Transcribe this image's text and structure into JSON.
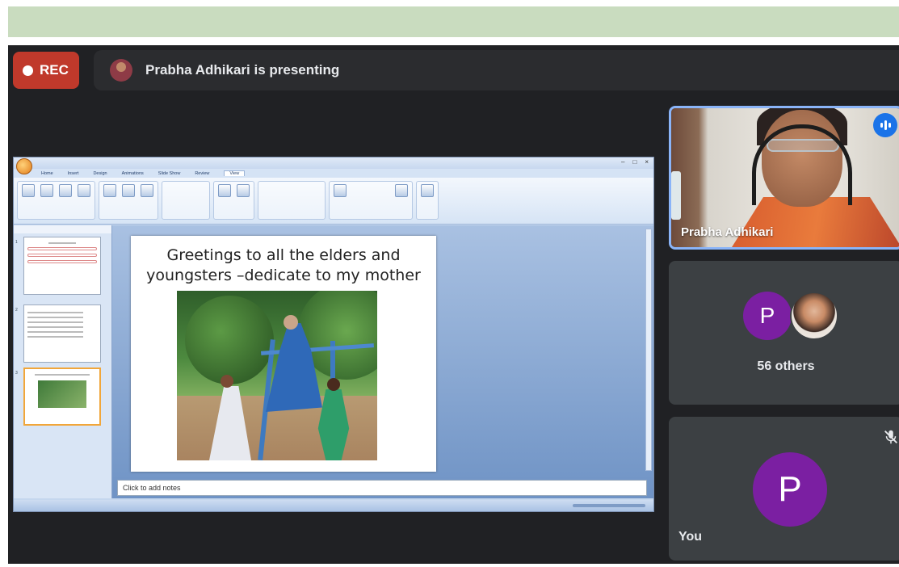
{
  "recording": {
    "label": "REC"
  },
  "presenting_bar": {
    "text": "Prabha Adhikari is presenting"
  },
  "shared_screen": {
    "ribbon_tabs": [
      "Home",
      "Insert",
      "Design",
      "Animations",
      "Slide Show",
      "Review",
      "View"
    ],
    "active_tab": "View",
    "slide": {
      "title_line1": "Greetings to all the elders and",
      "title_line2": "youngsters –dedicate to my mother"
    },
    "thumbnails": [
      {
        "number": "1"
      },
      {
        "number": "2"
      },
      {
        "number": "3"
      }
    ],
    "notes_placeholder": "Click to add notes"
  },
  "tiles": {
    "presenter": {
      "name": "Prabha Adhikari",
      "speaking_icon": "speaking-indicator-icon"
    },
    "others": {
      "avatar_letter": "P",
      "label": "56 others"
    },
    "self": {
      "avatar_letter": "P",
      "label": "You",
      "mic_icon": "mic-off-icon"
    }
  },
  "colors": {
    "background": "#202124",
    "tile": "#3c4043",
    "rec": "#c0392b",
    "avatar": "#7b1fa2",
    "active_speaker_border": "#8ab4f8",
    "top_band": "#c9dcbf"
  }
}
